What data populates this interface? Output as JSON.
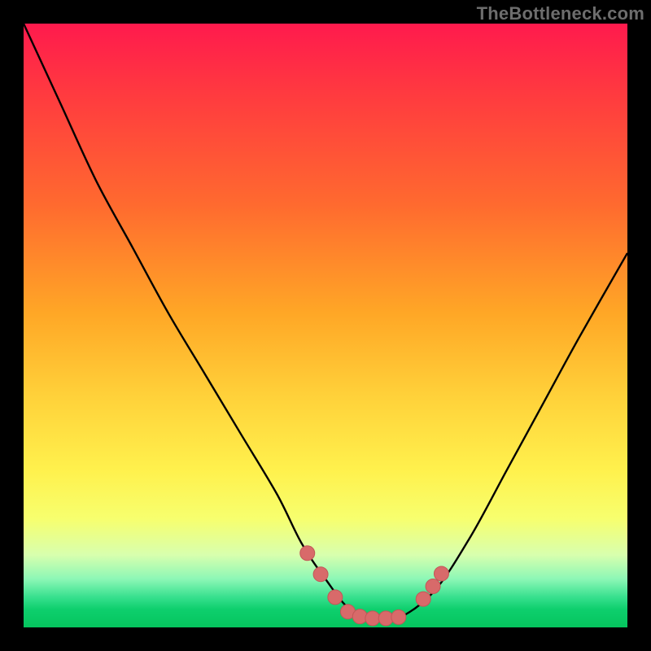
{
  "watermark": {
    "text": "TheBottleneck.com"
  },
  "colors": {
    "frame": "#000000",
    "curve_stroke": "#000000",
    "marker_fill": "#d86a6a",
    "marker_stroke": "#c25757"
  },
  "chart_data": {
    "type": "line",
    "title": "",
    "xlabel": "",
    "ylabel": "",
    "xlim": [
      0,
      100
    ],
    "ylim": [
      0,
      100
    ],
    "grid": false,
    "series": [
      {
        "name": "bottleneck-curve",
        "x": [
          0,
          6,
          12,
          18,
          24,
          30,
          36,
          42,
          46,
          50,
          54,
          58,
          62,
          68,
          74,
          80,
          86,
          92,
          100
        ],
        "y": [
          100,
          87,
          74,
          63,
          52,
          42,
          32,
          22,
          14,
          8,
          3,
          1.5,
          1.5,
          6,
          15,
          26,
          37,
          48,
          62
        ]
      }
    ],
    "markers": [
      {
        "series": "bottleneck-curve",
        "x": 47.0,
        "y": 12.3
      },
      {
        "series": "bottleneck-curve",
        "x": 49.2,
        "y": 8.8
      },
      {
        "series": "bottleneck-curve",
        "x": 51.6,
        "y": 5.0
      },
      {
        "series": "bottleneck-curve",
        "x": 53.7,
        "y": 2.6
      },
      {
        "series": "bottleneck-curve",
        "x": 55.7,
        "y": 1.8
      },
      {
        "series": "bottleneck-curve",
        "x": 57.8,
        "y": 1.5
      },
      {
        "series": "bottleneck-curve",
        "x": 60.0,
        "y": 1.5
      },
      {
        "series": "bottleneck-curve",
        "x": 62.1,
        "y": 1.7
      },
      {
        "series": "bottleneck-curve",
        "x": 66.2,
        "y": 4.7
      },
      {
        "series": "bottleneck-curve",
        "x": 67.8,
        "y": 6.8
      },
      {
        "series": "bottleneck-curve",
        "x": 69.2,
        "y": 8.9
      }
    ]
  }
}
